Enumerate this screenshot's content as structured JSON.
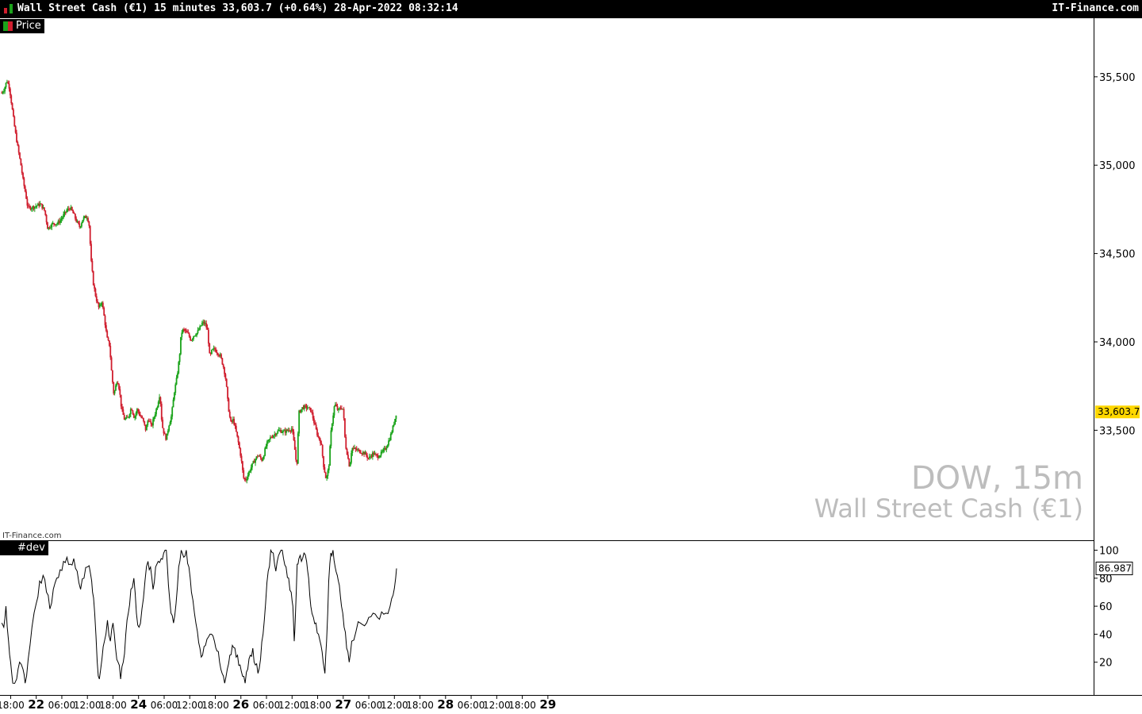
{
  "header": {
    "title": "Wall Street Cash (€1) 15 minutes 33,603.7 (+0.64%) 28-Apr-2022 08:32:14",
    "brand": "IT-Finance.com"
  },
  "panels": {
    "price_legend": "Price",
    "dev_legend": "#dev",
    "watermark_small": "IT-Finance.com",
    "watermark_symbol": "DOW, 15m",
    "watermark_name": "Wall Street Cash (€1)"
  },
  "colors": {
    "up": "#1aa31a",
    "down": "#d01f2f",
    "last_price_bg": "#ffd700",
    "line": "#000000"
  },
  "chart_data": [
    {
      "type": "candlestick",
      "title": "DOW, 15m",
      "interval": "15 minutes",
      "last_price": "33,603.7",
      "ylim": [
        32900,
        35800
      ],
      "yticks": [
        "35,500",
        "35,000",
        "34,500",
        "34,000",
        "33,500"
      ],
      "ytick_values": [
        35500,
        35000,
        34500,
        34000,
        33500
      ],
      "x_range_hours": [
        -56.5,
        200
      ],
      "xticks": [
        "18:00",
        "22",
        "06:00",
        "12:00",
        "18:00",
        "24",
        "06:00",
        "12:00",
        "18:00",
        "26",
        "06:00",
        "12:00",
        "18:00",
        "27",
        "06:00",
        "12:00",
        "18:00",
        "28",
        "06:00",
        "12:00",
        "18:00",
        "29"
      ],
      "xtick_hours": [
        -54,
        -48,
        -42,
        -36,
        -30,
        -24,
        -18,
        -12,
        -6,
        0,
        6,
        12,
        18,
        24,
        30,
        36,
        42,
        48,
        54,
        60,
        66,
        72
      ],
      "close_path": [
        [
          -56.1,
          35410
        ],
        [
          -55.5,
          35430
        ],
        [
          -54.9,
          35480
        ],
        [
          -54.3,
          35440
        ],
        [
          -53.7,
          35330
        ],
        [
          -53.0,
          35200
        ],
        [
          -52.4,
          35110
        ],
        [
          -51.6,
          35000
        ],
        [
          -51.0,
          34900
        ],
        [
          -50.5,
          34840
        ],
        [
          -50.0,
          34760
        ],
        [
          -49.0,
          34760
        ],
        [
          -48.0,
          34770
        ],
        [
          -47.0,
          34780
        ],
        [
          -46.0,
          34740
        ],
        [
          -45.3,
          34640
        ],
        [
          -44.6,
          34660
        ],
        [
          -44.0,
          34670
        ],
        [
          -43.0,
          34670
        ],
        [
          -42.0,
          34700
        ],
        [
          -41.0,
          34740
        ],
        [
          -40.0,
          34760
        ],
        [
          -39.2,
          34720
        ],
        [
          -38.5,
          34680
        ],
        [
          -37.8,
          34650
        ],
        [
          -37.0,
          34700
        ],
        [
          -36.0,
          34710
        ],
        [
          -35.6,
          34660
        ],
        [
          -35.1,
          34450
        ],
        [
          -34.6,
          34330
        ],
        [
          -34.0,
          34250
        ],
        [
          -33.3,
          34190
        ],
        [
          -32.6,
          34230
        ],
        [
          -32.0,
          34130
        ],
        [
          -31.4,
          34020
        ],
        [
          -30.8,
          33980
        ],
        [
          -30.3,
          33820
        ],
        [
          -29.8,
          33700
        ],
        [
          -29.0,
          33790
        ],
        [
          -28.5,
          33730
        ],
        [
          -28.0,
          33620
        ],
        [
          -27.3,
          33560
        ],
        [
          -26.5,
          33570
        ],
        [
          -25.7,
          33630
        ],
        [
          -25.0,
          33570
        ],
        [
          -24.3,
          33620
        ],
        [
          -23.6,
          33580
        ],
        [
          -23.0,
          33560
        ],
        [
          -22.3,
          33500
        ],
        [
          -21.7,
          33570
        ],
        [
          -21.0,
          33520
        ],
        [
          -20.3,
          33580
        ],
        [
          -19.6,
          33640
        ],
        [
          -19.0,
          33710
        ],
        [
          -18.5,
          33530
        ],
        [
          -18.0,
          33480
        ],
        [
          -17.5,
          33450
        ],
        [
          -16.9,
          33530
        ],
        [
          -16.3,
          33580
        ],
        [
          -15.6,
          33720
        ],
        [
          -15.0,
          33800
        ],
        [
          -14.4,
          33920
        ],
        [
          -14.0,
          34050
        ],
        [
          -13.5,
          34070
        ],
        [
          -13.0,
          34060
        ],
        [
          -12.3,
          34040
        ],
        [
          -11.7,
          34010
        ],
        [
          -11.0,
          34040
        ],
        [
          -10.3,
          34050
        ],
        [
          -9.6,
          34080
        ],
        [
          -9.0,
          34110
        ],
        [
          -8.3,
          34100
        ],
        [
          -7.8,
          34060
        ],
        [
          -7.3,
          33910
        ],
        [
          -6.8,
          33950
        ],
        [
          -6.2,
          33960
        ],
        [
          -5.5,
          33940
        ],
        [
          -4.8,
          33920
        ],
        [
          -4.0,
          33850
        ],
        [
          -3.5,
          33780
        ],
        [
          -3.0,
          33640
        ],
        [
          -2.4,
          33540
        ],
        [
          -1.8,
          33560
        ],
        [
          -1.2,
          33500
        ],
        [
          -0.6,
          33430
        ],
        [
          0.0,
          33350
        ],
        [
          0.6,
          33230
        ],
        [
          1.2,
          33220
        ],
        [
          2.0,
          33270
        ],
        [
          3.0,
          33320
        ],
        [
          4.0,
          33360
        ],
        [
          5.0,
          33330
        ],
        [
          6.0,
          33420
        ],
        [
          7.0,
          33460
        ],
        [
          8.0,
          33480
        ],
        [
          9.0,
          33500
        ],
        [
          10.0,
          33490
        ],
        [
          11.0,
          33500
        ],
        [
          12.0,
          33510
        ],
        [
          12.6,
          33400
        ],
        [
          13.1,
          33290
        ],
        [
          13.6,
          33600
        ],
        [
          14.5,
          33630
        ],
        [
          15.5,
          33630
        ],
        [
          16.5,
          33610
        ],
        [
          17.2,
          33540
        ],
        [
          18.0,
          33470
        ],
        [
          18.8,
          33430
        ],
        [
          19.4,
          33300
        ],
        [
          20.0,
          33220
        ],
        [
          20.6,
          33290
        ],
        [
          21.2,
          33510
        ],
        [
          22.0,
          33650
        ],
        [
          22.8,
          33610
        ],
        [
          23.5,
          33630
        ],
        [
          24.0,
          33620
        ],
        [
          24.5,
          33420
        ],
        [
          25.0,
          33360
        ],
        [
          25.5,
          33290
        ],
        [
          26.0,
          33400
        ],
        [
          27.0,
          33390
        ],
        [
          28.0,
          33380
        ],
        [
          29.0,
          33370
        ],
        [
          30.0,
          33340
        ],
        [
          31.0,
          33370
        ],
        [
          32.0,
          33350
        ],
        [
          33.0,
          33370
        ],
        [
          34.0,
          33400
        ],
        [
          35.0,
          33460
        ],
        [
          35.8,
          33530
        ],
        [
          36.5,
          33603.7
        ]
      ]
    },
    {
      "type": "line",
      "series_label": "#dev",
      "last_value": "86.987",
      "ylim": [
        0,
        102
      ],
      "yticks": [
        "100",
        "80",
        "60",
        "40",
        "20"
      ],
      "ytick_values": [
        100,
        80,
        60,
        40,
        20
      ],
      "x_range_hours": [
        -56.5,
        200
      ],
      "points": [
        [
          -56.1,
          48
        ],
        [
          -55.6,
          45
        ],
        [
          -55.1,
          60
        ],
        [
          -54.5,
          35
        ],
        [
          -54.0,
          20
        ],
        [
          -53.5,
          5
        ],
        [
          -52.6,
          8
        ],
        [
          -51.9,
          20
        ],
        [
          -51.1,
          15
        ],
        [
          -50.6,
          5
        ],
        [
          -49.9,
          22
        ],
        [
          -49.0,
          45
        ],
        [
          -48.0,
          62
        ],
        [
          -47.2,
          78
        ],
        [
          -46.4,
          82
        ],
        [
          -45.6,
          70
        ],
        [
          -44.8,
          58
        ],
        [
          -44.0,
          72
        ],
        [
          -43.2,
          80
        ],
        [
          -42.4,
          86
        ],
        [
          -41.6,
          92
        ],
        [
          -40.8,
          95
        ],
        [
          -40.0,
          90
        ],
        [
          -39.2,
          94
        ],
        [
          -38.4,
          85
        ],
        [
          -37.6,
          72
        ],
        [
          -36.8,
          80
        ],
        [
          -36.0,
          88
        ],
        [
          -35.2,
          82
        ],
        [
          -34.8,
          70
        ],
        [
          -34.3,
          55
        ],
        [
          -33.7,
          20
        ],
        [
          -33.2,
          8
        ],
        [
          -32.6,
          22
        ],
        [
          -32.0,
          35
        ],
        [
          -31.3,
          50
        ],
        [
          -30.6,
          35
        ],
        [
          -30.0,
          48
        ],
        [
          -29.4,
          30
        ],
        [
          -28.8,
          20
        ],
        [
          -28.2,
          8
        ],
        [
          -27.6,
          20
        ],
        [
          -27.0,
          40
        ],
        [
          -26.4,
          55
        ],
        [
          -25.8,
          72
        ],
        [
          -25.1,
          80
        ],
        [
          -24.5,
          55
        ],
        [
          -23.9,
          45
        ],
        [
          -23.2,
          58
        ],
        [
          -22.5,
          78
        ],
        [
          -21.8,
          92
        ],
        [
          -21.2,
          88
        ],
        [
          -20.6,
          72
        ],
        [
          -20.0,
          88
        ],
        [
          -19.4,
          92
        ],
        [
          -18.7,
          94
        ],
        [
          -18.1,
          98
        ],
        [
          -17.5,
          100
        ],
        [
          -17.0,
          75
        ],
        [
          -16.4,
          55
        ],
        [
          -15.8,
          48
        ],
        [
          -15.2,
          62
        ],
        [
          -14.6,
          88
        ],
        [
          -14.0,
          100
        ],
        [
          -13.4,
          95
        ],
        [
          -12.8,
          100
        ],
        [
          -12.2,
          88
        ],
        [
          -11.6,
          70
        ],
        [
          -10.9,
          55
        ],
        [
          -10.2,
          42
        ],
        [
          -9.6,
          30
        ],
        [
          -9.0,
          25
        ],
        [
          -8.3,
          32
        ],
        [
          -7.6,
          38
        ],
        [
          -6.9,
          40
        ],
        [
          -6.2,
          35
        ],
        [
          -5.6,
          28
        ],
        [
          -5.0,
          20
        ],
        [
          -4.4,
          12
        ],
        [
          -3.8,
          5
        ],
        [
          -3.2,
          15
        ],
        [
          -2.6,
          25
        ],
        [
          -2.0,
          32
        ],
        [
          -1.4,
          30
        ],
        [
          -0.8,
          25
        ],
        [
          -0.2,
          18
        ],
        [
          0.4,
          10
        ],
        [
          1.0,
          5
        ],
        [
          1.6,
          15
        ],
        [
          2.2,
          25
        ],
        [
          2.8,
          30
        ],
        [
          3.4,
          18
        ],
        [
          4.0,
          12
        ],
        [
          4.6,
          22
        ],
        [
          5.2,
          40
        ],
        [
          5.8,
          62
        ],
        [
          6.4,
          85
        ],
        [
          7.0,
          100
        ],
        [
          7.6,
          98
        ],
        [
          8.2,
          85
        ],
        [
          8.8,
          96
        ],
        [
          9.4,
          100
        ],
        [
          10.0,
          94
        ],
        [
          10.6,
          88
        ],
        [
          11.2,
          80
        ],
        [
          11.8,
          70
        ],
        [
          12.2,
          60
        ],
        [
          12.5,
          35
        ],
        [
          12.8,
          55
        ],
        [
          13.2,
          90
        ],
        [
          13.6,
          94
        ],
        [
          14.2,
          92
        ],
        [
          14.8,
          98
        ],
        [
          15.4,
          92
        ],
        [
          15.9,
          80
        ],
        [
          16.4,
          60
        ],
        [
          17.0,
          52
        ],
        [
          17.6,
          48
        ],
        [
          18.2,
          40
        ],
        [
          18.8,
          32
        ],
        [
          19.3,
          20
        ],
        [
          19.7,
          12
        ],
        [
          20.1,
          35
        ],
        [
          20.6,
          78
        ],
        [
          21.1,
          98
        ],
        [
          21.6,
          100
        ],
        [
          22.1,
          88
        ],
        [
          22.6,
          82
        ],
        [
          23.1,
          75
        ],
        [
          23.6,
          60
        ],
        [
          24.2,
          45
        ],
        [
          24.8,
          30
        ],
        [
          25.4,
          20
        ],
        [
          26.0,
          35
        ],
        [
          27.0,
          42
        ],
        [
          28.0,
          48
        ],
        [
          29.0,
          46
        ],
        [
          30.0,
          52
        ],
        [
          31.0,
          55
        ],
        [
          32.0,
          52
        ],
        [
          33.0,
          56
        ],
        [
          34.0,
          55
        ],
        [
          35.0,
          60
        ],
        [
          35.7,
          68
        ],
        [
          36.3,
          80
        ],
        [
          36.5,
          86.987
        ]
      ]
    }
  ]
}
